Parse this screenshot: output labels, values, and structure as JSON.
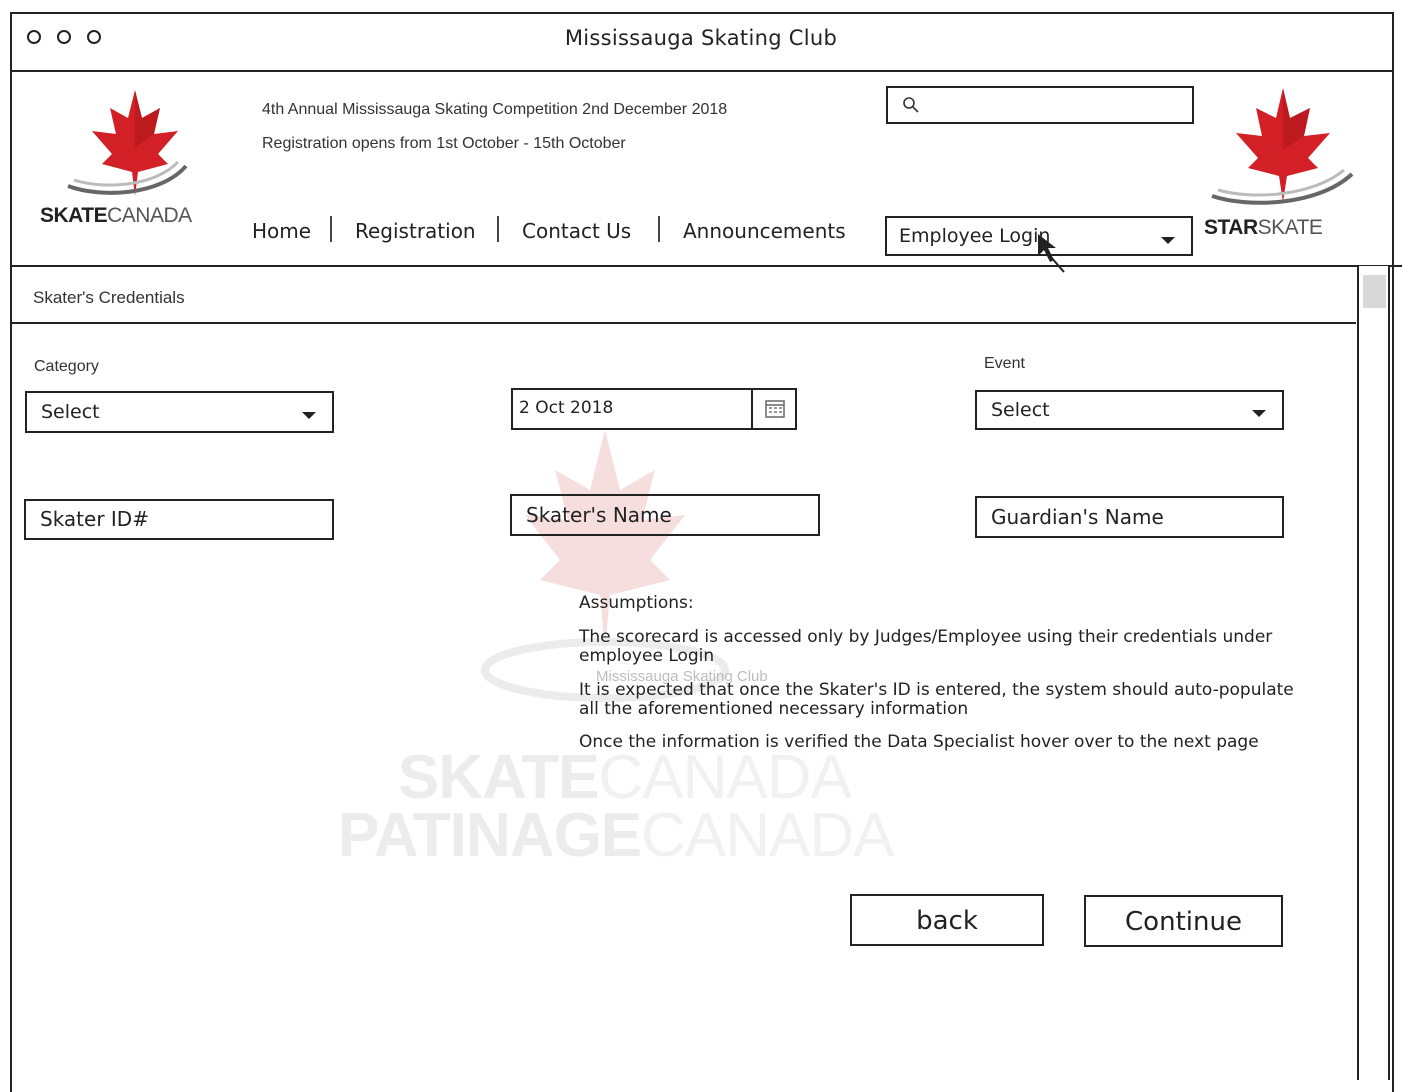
{
  "window": {
    "title": "Mississauga Skating Club"
  },
  "logos": {
    "left": {
      "bold": "SKATE",
      "thin": "CANADA"
    },
    "right": {
      "bold": "STAR",
      "thin": "SKATE"
    }
  },
  "header": {
    "line1": "4th Annual Mississauga Skating Competition 2nd December 2018",
    "line2": "Registration opens from 1st October - 15th October"
  },
  "search": {
    "placeholder": ""
  },
  "nav": {
    "items": [
      "Home",
      "Registration",
      "Contact Us",
      "Announcements"
    ]
  },
  "login": {
    "label": "Employee Login"
  },
  "section": {
    "title": "Skater's Credentials"
  },
  "form": {
    "category_label": "Category",
    "category_value": "Select",
    "date_value": "2 Oct 2018",
    "event_label": "Event",
    "event_value": "Select",
    "skater_id": "Skater ID#",
    "skater_name": "Skater's Name",
    "guardian_name": "Guardian's Name"
  },
  "assumptions": {
    "heading": "Assumptions:",
    "p1": "The scorecard is accessed only by Judges/Employee using their credentials under employee Login",
    "p2": "It is expected that once the Skater's ID is entered, the system should auto-populate all the aforementioned necessary information",
    "p3": "Once the information is verified the Data Specialist hover over to the next page"
  },
  "watermark": {
    "line1_bold": "SKATE",
    "line1_thin": "CANADA",
    "line2_bold": "PATINAGE",
    "line2_thin": "CANADA",
    "caption": "Mississauga Skating Club"
  },
  "buttons": {
    "back": "back",
    "continue": "Continue"
  },
  "colors": {
    "leaf_red": "#d32027",
    "leaf_dark": "#a8141a",
    "line": "#222222"
  }
}
